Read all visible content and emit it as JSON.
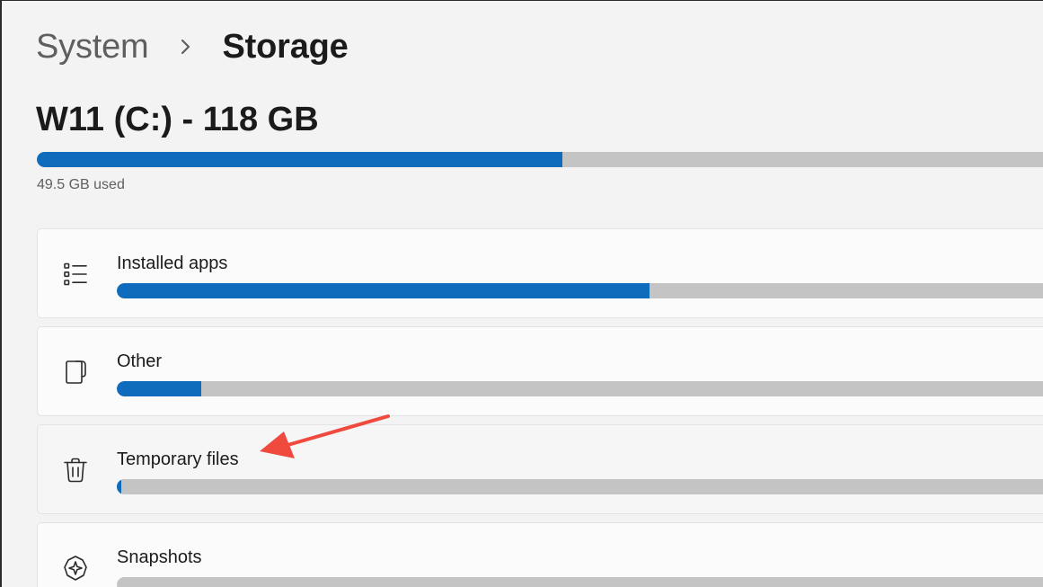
{
  "breadcrumb": {
    "parent": "System",
    "separator_icon": "chevron-right-icon",
    "current": "Storage"
  },
  "drive": {
    "title": "W11 (C:) - 118 GB",
    "used_label": "49.5 GB used",
    "used_fraction": 0.513,
    "accent_color": "#0f6cbd",
    "track_color": "#c4c4c4"
  },
  "categories": [
    {
      "label": "Installed apps",
      "icon": "list-icon",
      "used_fraction": 0.57
    },
    {
      "label": "Other",
      "icon": "document-icon",
      "used_fraction": 0.09
    },
    {
      "label": "Temporary files",
      "icon": "trash-icon",
      "used_fraction": 0.004
    },
    {
      "label": "Snapshots",
      "icon": "snapshot-icon",
      "used_fraction": 0.0
    }
  ],
  "annotation": {
    "type": "red-arrow",
    "color": "#f04a3e",
    "points_to": "Temporary files"
  }
}
